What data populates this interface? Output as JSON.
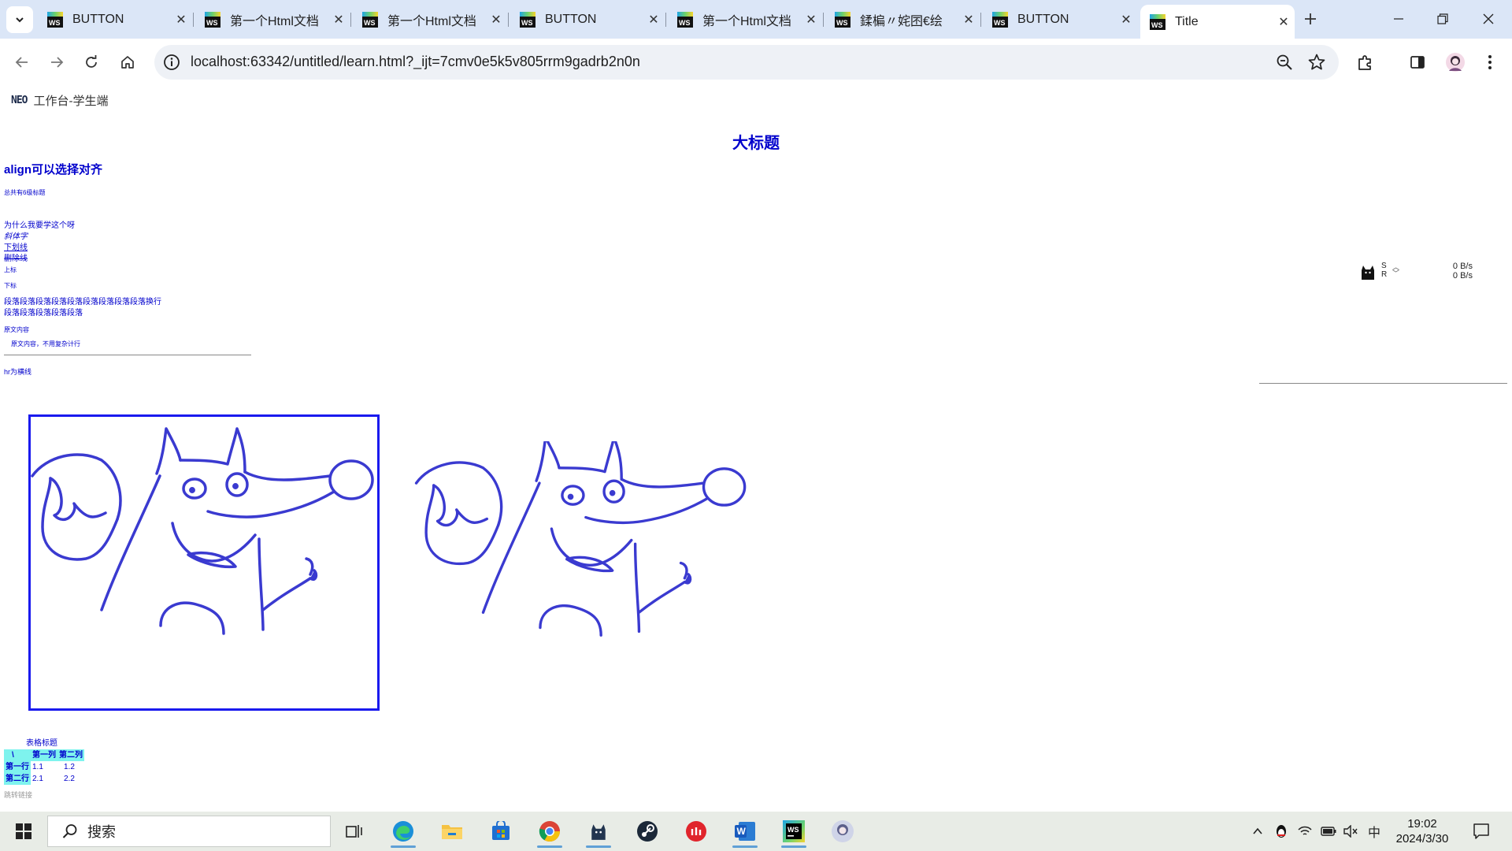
{
  "browser": {
    "tabs": [
      {
        "title": "BUTTON",
        "active": false
      },
      {
        "title": "第一个Html文档",
        "active": false
      },
      {
        "title": "第一个Html文档",
        "active": false
      },
      {
        "title": "BUTTON",
        "active": false
      },
      {
        "title": "第一个Html文档",
        "active": false
      },
      {
        "title": "鍒楄〃姹囨€绘",
        "active": false
      },
      {
        "title": "BUTTON",
        "active": false
      },
      {
        "title": "Title",
        "active": true
      }
    ],
    "url": "localhost:63342/untitled/learn.html?_ijt=7cmv0e5k5v805rrm9gadrb2n0n"
  },
  "page": {
    "brand_logo": "NEO",
    "brand_text": "工作台-学生端",
    "big_title": "大标题",
    "align_title": "align可以选择对齐",
    "small_heading": "总共有6级标题",
    "line_why": "为什么我要学这个呀",
    "line_italic": "斜体字",
    "line_underline": "下划线",
    "line_strike": "删除线",
    "line_sup": "上标",
    "line_sub": "下标",
    "para_line1": "段落段落段落段落段落段落段落段落段落换行",
    "para_line2": "段落段落段落段落段落",
    "pre_line1": "原文内容",
    "pre_line2": "原文内容，不用复杂计行",
    "hr_label": "hr为横线",
    "table": {
      "caption": "表格标题",
      "headers": [
        "\\",
        "第一列",
        "第二列"
      ],
      "rows": [
        [
          "第一行",
          "1.1",
          "1.2"
        ],
        [
          "第二行",
          "2.1",
          "2.2"
        ]
      ]
    },
    "footnote": "跳转链接"
  },
  "net_widget": {
    "s_label": "S",
    "r_label": "R",
    "up_rate": "0 B/s",
    "down_rate": "0 B/s"
  },
  "taskbar": {
    "search_placeholder": "搜索",
    "time": "19:02",
    "date": "2024/3/30",
    "ime": "中"
  },
  "colors": {
    "page_text": "#0000cc",
    "table_header_bg": "#7ef3ee",
    "fox_stroke": "#3a3ad0",
    "frame_border": "#1a1aee",
    "tabstrip_bg": "#dbe6f7"
  }
}
